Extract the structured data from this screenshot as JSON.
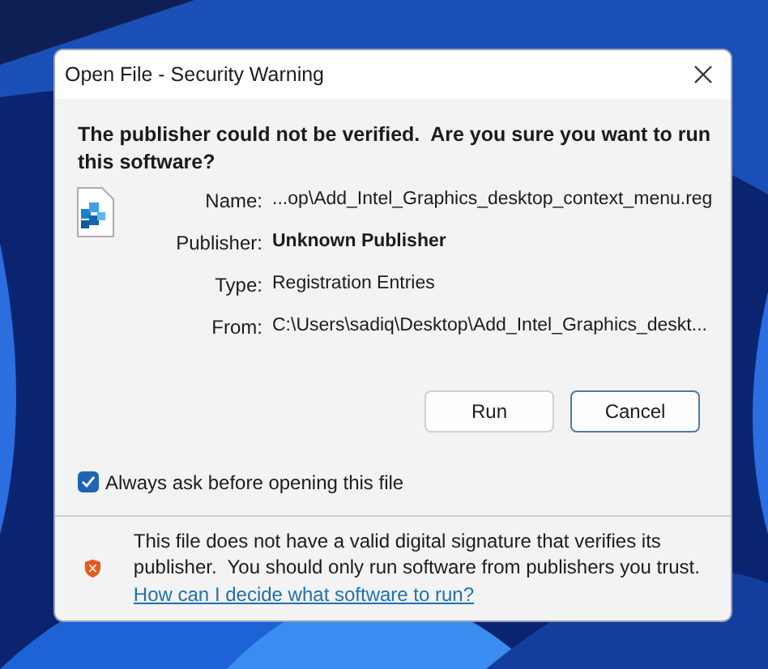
{
  "window": {
    "title": "Open File - Security Warning"
  },
  "heading": "The publisher could not be verified.  Are you sure you want to run this software?",
  "fields": [
    {
      "label": "Name:",
      "value": "...op\\Add_Intel_Graphics_desktop_context_menu.reg",
      "bold": false
    },
    {
      "label": "Publisher:",
      "value": "Unknown Publisher",
      "bold": true
    },
    {
      "label": "Type:",
      "value": "Registration Entries",
      "bold": false
    },
    {
      "label": "From:",
      "value": "C:\\Users\\sadiq\\Desktop\\Add_Intel_Graphics_deskt...",
      "bold": false
    }
  ],
  "buttons": [
    {
      "label": "Run",
      "default": false
    },
    {
      "label": "Cancel",
      "default": true
    }
  ],
  "checkbox": {
    "label": "Always ask before opening this file",
    "checked": true
  },
  "footer": {
    "text": "This file does not have a valid digital signature that verifies its publisher.  You should only run software from publishers you trust.",
    "link": "How can I decide what software to run?"
  }
}
